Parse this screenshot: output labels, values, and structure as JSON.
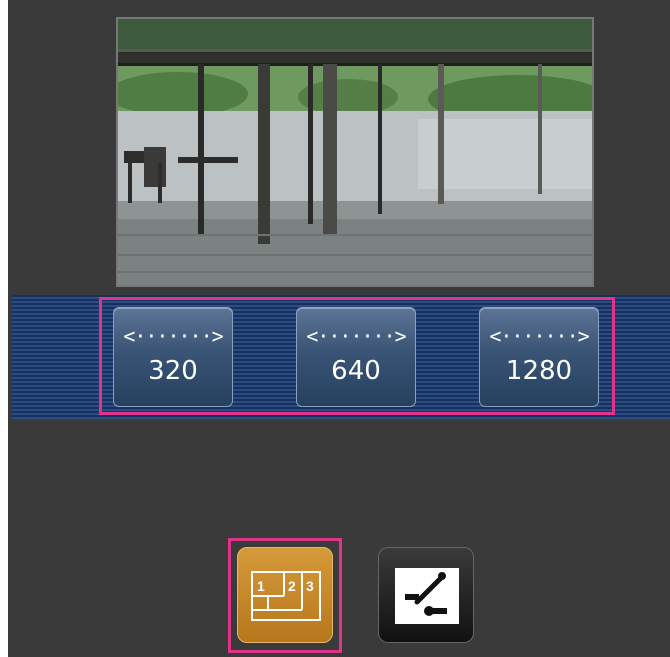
{
  "camera": {
    "image_description_icon": "camera-live-image"
  },
  "resolution_buttons": [
    {
      "arrow": "<·······>",
      "label": "320"
    },
    {
      "arrow": "<·······>",
      "label": "640"
    },
    {
      "arrow": "<·······>",
      "label": "1280"
    }
  ],
  "mode_buttons": {
    "multiscreen": {
      "icon": "multiscreen-icon",
      "digits": [
        "1",
        "2",
        "3"
      ]
    },
    "control": {
      "icon": "control-panel-icon"
    }
  },
  "colors": {
    "highlight": "#e0338a",
    "bar_dark": "#17315c",
    "bar_light": "#2a4d86",
    "multiscreen_button": "#c98a2c"
  }
}
